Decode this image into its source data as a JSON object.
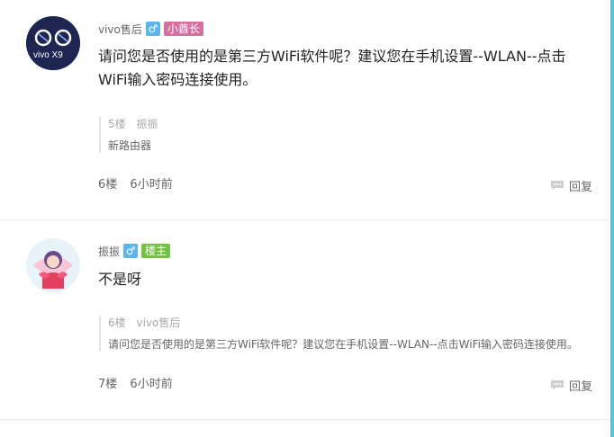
{
  "posts": [
    {
      "author": "vivo售后",
      "gender_symbol": "♂",
      "badge": "小酋长",
      "content": "请问您是否使用的是第三方WiFi软件呢？建议您在手机设置--WLAN--点击WiFi输入密码连接使用。",
      "quote": {
        "floor": "5楼",
        "author": "振振",
        "text": "新路由器"
      },
      "floor": "6楼",
      "time": "6小时前",
      "reply_label": "回复",
      "avatar_text": "vivo X9"
    },
    {
      "author": "振振",
      "gender_symbol": "♂",
      "badge": "楼主",
      "content": "不是呀",
      "quote": {
        "floor": "6楼",
        "author": "vivo售后",
        "text": "请问您是否使用的是第三方WiFi软件呢？建议您在手机设置--WLAN--点击WiFi输入密码连接使用。"
      },
      "floor": "7楼",
      "time": "6小时前",
      "reply_label": "回复"
    }
  ],
  "colors": {
    "accent_bar": "#5fc1d8",
    "badge_pink": "#d46f9e",
    "badge_green": "#73c242",
    "gender_blue": "#5fb5ea"
  }
}
